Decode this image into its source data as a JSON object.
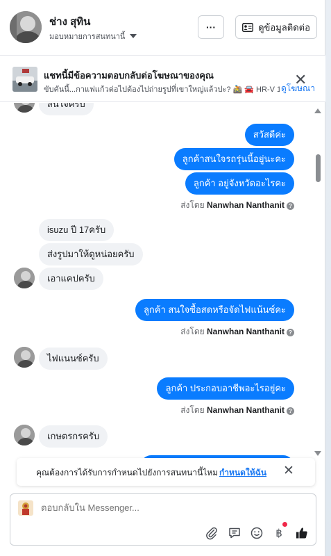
{
  "header": {
    "contact_name": "ช่าง สุทิน",
    "assign_label": "มอบหมายการสนทนานี้",
    "more_label": "···",
    "contact_info_label": "ดูข้อมูลติดต่อ"
  },
  "ad_banner": {
    "title": "แชทนี้มีข้อความตอบกลับต่อโฆษณาของคุณ",
    "subtitle": "ขับคันนี้...กาแฟแก้วต่อไปต้องไปถ่ายรูปที่เขาใหญ่แล้วปะ? 🚵 🚘 HR-V 1....",
    "link_label": "ดูโฆษณา",
    "close_label": "✕"
  },
  "messages": {
    "partial_top": "สนใจครับ",
    "out_1": "สวัสดีค่ะ",
    "out_2": "ลูกค้าสนใจรถรุ่นนี้อยู่นะคะ",
    "out_3": "ลูกค้า อยู่จังหวัดอะไรคะ",
    "sent_by_prefix": "ส่งโดย",
    "sent_by_name": "Nanwhan Nanthanit",
    "help_glyph": "?",
    "in_1": "isuzu ปี 17ครับ",
    "in_2": "ส่งรูปมาให้ดูหน่อยครับ",
    "in_3": "เอาแคปครับ",
    "out_4": "ลูกค้า  สนใจซื้อสดหรือจัดไฟแน้นซ์คะ",
    "in_4": "ไฟแนนซ์ครับ",
    "out_5": "ลูกค้า ประกอบอาชีพอะไรอยู่คะ",
    "in_5": "เกษตรกรครับ"
  },
  "assign_prompt": {
    "text": "คุณต้องการได้รับการกำหนดไปยังการสนทนานี้ไหม",
    "link": "กำหนดให้ฉัน",
    "close_label": "✕"
  },
  "composer": {
    "placeholder": "ตอบกลับใน Messenger..."
  },
  "colors": {
    "outgoing_bubble": "#0a7cff",
    "incoming_bubble": "#f0f2f5",
    "link": "#1877f2",
    "badge": "#f02849"
  },
  "icons": [
    "more-icon",
    "contact-card-icon",
    "close-icon",
    "paperclip-icon",
    "saved-reply-icon",
    "emoji-icon",
    "payment-icon",
    "like-icon"
  ]
}
